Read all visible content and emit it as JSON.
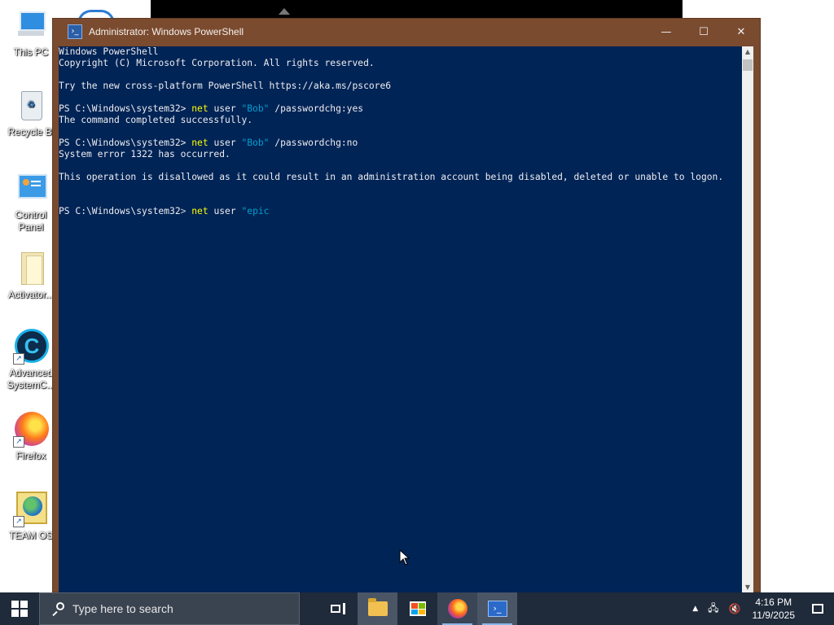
{
  "desktop": {
    "icons": [
      {
        "label": "This PC",
        "icon": "this-pc-icon"
      },
      {
        "label": "Recycle Bi",
        "icon": "recycle-bin-icon"
      },
      {
        "label": "Control Panel",
        "icon": "control-panel-icon"
      },
      {
        "label": "Activator...",
        "icon": "folder-icon"
      },
      {
        "label": "Advanced SystemC...",
        "icon": "advanced-systemcare-icon"
      },
      {
        "label": "Firefox",
        "icon": "firefox-icon"
      },
      {
        "label": "TEAM OS",
        "icon": "team-os-icon"
      }
    ]
  },
  "window": {
    "title": "Administrator: Windows PowerShell",
    "min": "—",
    "max": "☐",
    "close": "✕"
  },
  "console": {
    "l1": "Windows PowerShell",
    "l2": "Copyright (C) Microsoft Corporation. All rights reserved.",
    "l3": "Try the new cross-platform PowerShell https://aka.ms/pscore6",
    "p1_prompt": "PS C:\\Windows\\system32> ",
    "p1_cmd": "net",
    "p1_mid": " user ",
    "p1_str": "\"Bob\"",
    "p1_arg": " /passwordchg:yes",
    "r1": "The command completed successfully.",
    "p2_prompt": "PS C:\\Windows\\system32> ",
    "p2_cmd": "net",
    "p2_mid": " user ",
    "p2_str": "\"Bob\"",
    "p2_arg": " /passwordchg:no",
    "r2a": "System error 1322 has occurred.",
    "r2b": "This operation is disallowed as it could result in an administration account being disabled, deleted or unable to logon.",
    "p3_prompt": "PS C:\\Windows\\system32",
    "p3_gt": "> ",
    "p3_cmd": "net",
    "p3_mid": " user ",
    "p3_str": "\"epic"
  },
  "taskbar": {
    "search_placeholder": "Type here to search",
    "time": "4:16 PM",
    "date": "11/9/2025",
    "tray_up": "▲",
    "network": "🖧",
    "volume": "🔇"
  }
}
